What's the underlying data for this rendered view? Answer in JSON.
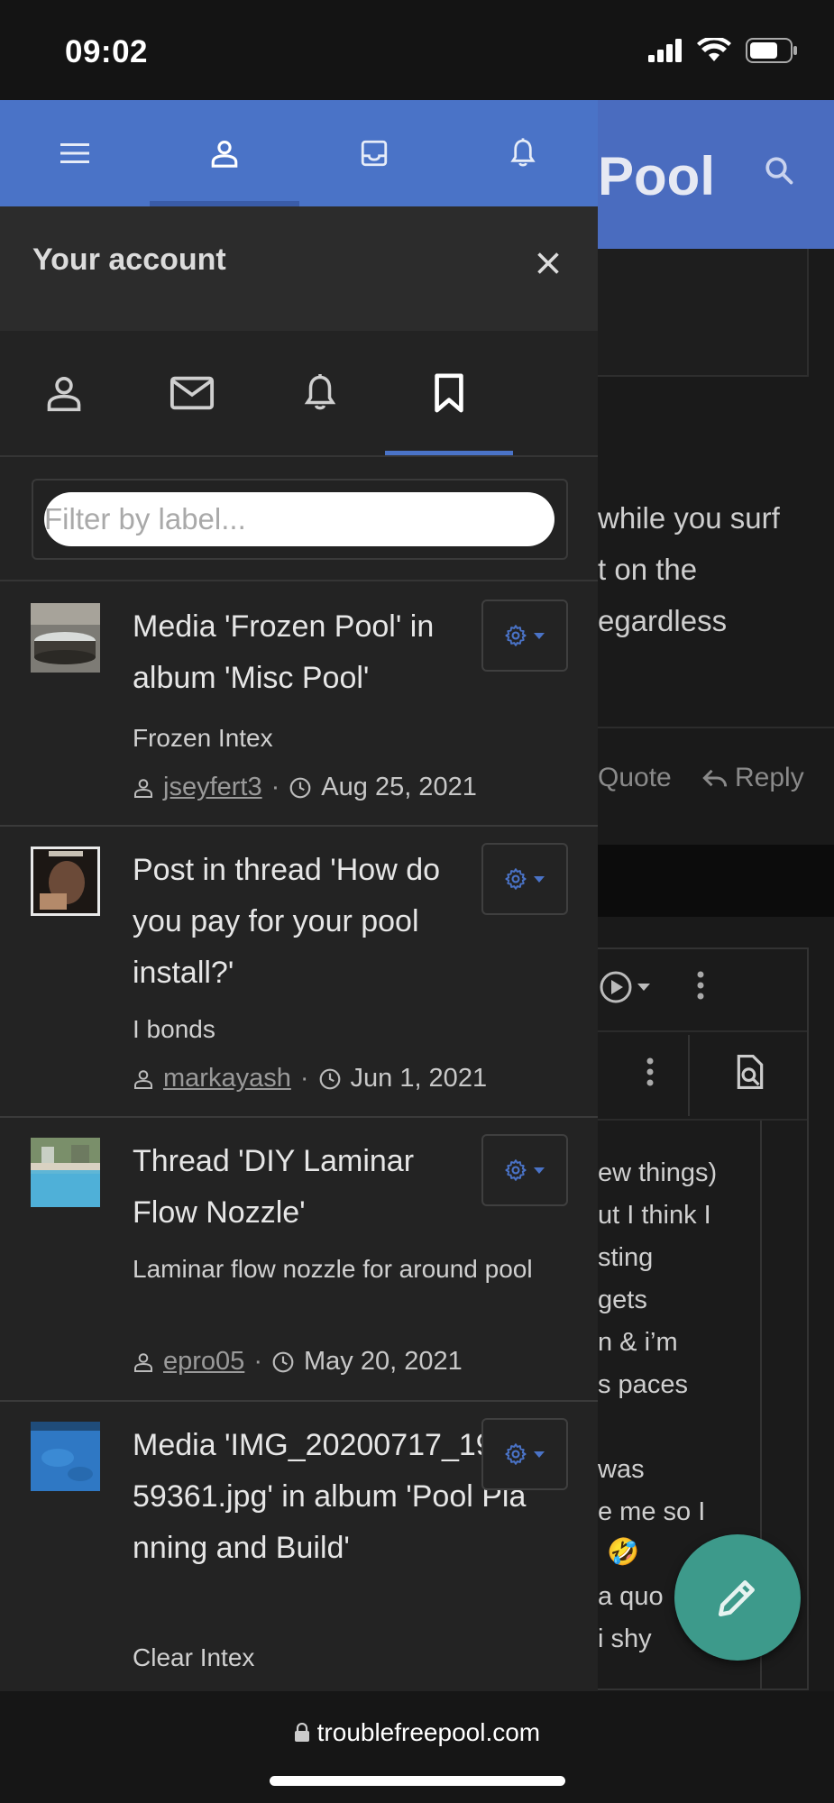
{
  "status_bar": {
    "time": "09:02"
  },
  "background_page": {
    "header_title": "Pool",
    "text_lines": [
      "while you surf",
      "t on the",
      "egardless"
    ],
    "actions": {
      "quote": "Quote",
      "reply": "Reply"
    },
    "editor_lines": [
      "ew things)",
      "ut I think I",
      "sting",
      "gets",
      "n & i’m",
      "s paces",
      "",
      "was",
      "e me so I",
      "🤣",
      "a quo",
      "i shy"
    ]
  },
  "drawer": {
    "account_title": "Your account",
    "filter": {
      "placeholder": "Filter by label...",
      "value": ""
    },
    "bookmarks": [
      {
        "title": "Media 'Frozen Pool' in album 'Misc Pool'",
        "snippet": "Frozen Intex",
        "user": "jseyfert3",
        "date": "Aug 25, 2021",
        "thumb_color": "#8c8a84"
      },
      {
        "title": "Post in thread 'How do you pay for your pool install?'",
        "snippet": "I bonds",
        "user": "markayash",
        "date": "Jun 1, 2021",
        "thumb_color": "#3b2a22"
      },
      {
        "title": "Thread 'DIY Laminar Flow Nozzle'",
        "snippet": "Laminar flow nozzle for around pool",
        "user": "epro05",
        "date": "May 20, 2021",
        "thumb_color": "#5fb6d6"
      },
      {
        "title": "Media 'IMG_20200717_193759361.jpg' in album 'Pool Planning and Build'",
        "snippet": "Clear Intex",
        "user": "",
        "date": "",
        "thumb_color": "#2f78c4"
      }
    ]
  },
  "url_bar": {
    "domain": "troublefreepool.com"
  },
  "colors": {
    "accent": "#4a73c7",
    "fab": "#3d9a8b",
    "drawer_bg": "#232323"
  }
}
